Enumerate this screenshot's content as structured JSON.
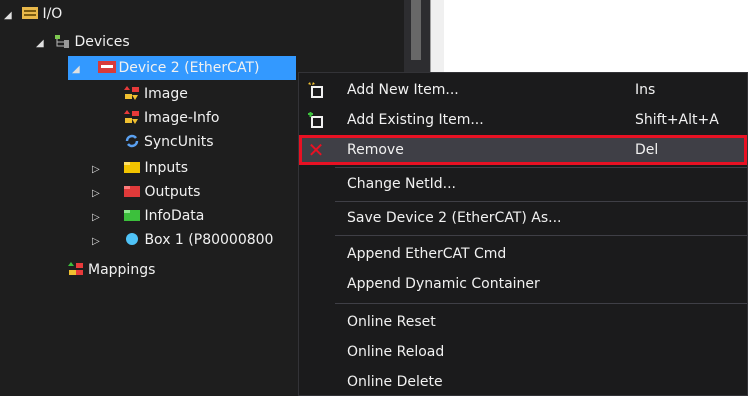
{
  "tree": {
    "items": [
      {
        "label": "I/O",
        "expander": "◢",
        "icon": "io-folder-icon"
      },
      {
        "label": "Devices",
        "expander": "◢",
        "icon": "devices-icon"
      },
      {
        "label": "Device 2 (EtherCAT)",
        "expander": "◢",
        "icon": "ethercat-device-icon"
      },
      {
        "label": "Image",
        "expander": "",
        "icon": "image-icon"
      },
      {
        "label": "Image-Info",
        "expander": "",
        "icon": "image-info-icon"
      },
      {
        "label": "SyncUnits",
        "expander": "",
        "icon": "syncunits-icon"
      },
      {
        "label": "Inputs",
        "expander": "▷",
        "icon": "inputs-icon"
      },
      {
        "label": "Outputs",
        "expander": "▷",
        "icon": "outputs-icon"
      },
      {
        "label": "InfoData",
        "expander": "▷",
        "icon": "infodata-icon"
      },
      {
        "label": "Box 1 (P80000800",
        "expander": "▷",
        "icon": "box-icon"
      },
      {
        "label": "Mappings",
        "expander": "",
        "icon": "mappings-icon"
      }
    ]
  },
  "menu": {
    "items": [
      {
        "label": "Add New Item...",
        "shortcut": "Ins",
        "icon": "add-new-item-icon"
      },
      {
        "label": "Add Existing Item...",
        "shortcut": "Shift+Alt+A",
        "icon": "add-existing-item-icon"
      },
      {
        "label": "Remove",
        "shortcut": "Del",
        "icon": "remove-icon"
      },
      {
        "label": "Change NetId...",
        "shortcut": ""
      },
      {
        "label": "Save Device 2 (EtherCAT) As...",
        "shortcut": ""
      },
      {
        "label": "Append EtherCAT Cmd",
        "shortcut": ""
      },
      {
        "label": "Append Dynamic Container",
        "shortcut": ""
      },
      {
        "label": "Online Reset",
        "shortcut": ""
      },
      {
        "label": "Online Reload",
        "shortcut": ""
      },
      {
        "label": "Online Delete",
        "shortcut": ""
      }
    ],
    "colors": {
      "highlight_border": "#e81123",
      "remove_icon": "#e81123",
      "selection": "#3399ff"
    }
  }
}
